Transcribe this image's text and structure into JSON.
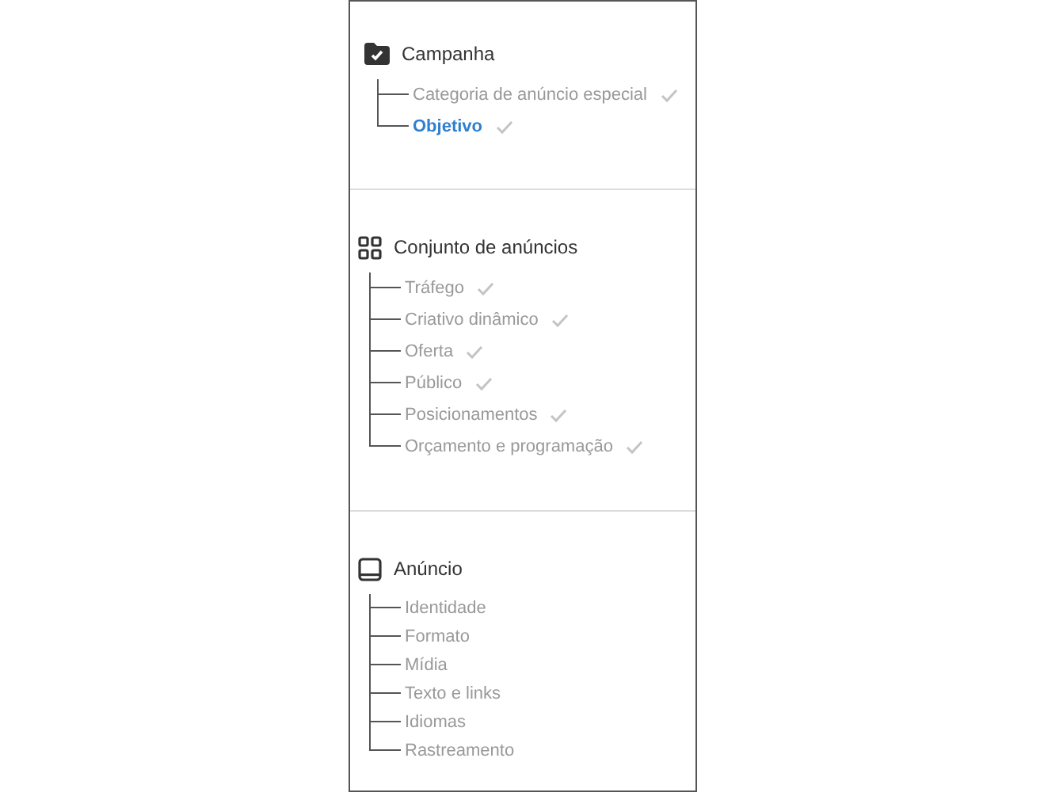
{
  "sections": [
    {
      "kind": "folder-check",
      "title": "Campanha",
      "items": [
        {
          "label": "Categoria de anúncio especial",
          "selected": false,
          "checked": true
        },
        {
          "label": "Objetivo",
          "selected": true,
          "checked": true
        }
      ]
    },
    {
      "kind": "grid",
      "title": "Conjunto de anúncios",
      "items": [
        {
          "label": "Tráfego",
          "selected": false,
          "checked": true
        },
        {
          "label": "Criativo dinâmico",
          "selected": false,
          "checked": true
        },
        {
          "label": "Oferta",
          "selected": false,
          "checked": true
        },
        {
          "label": "Público",
          "selected": false,
          "checked": true
        },
        {
          "label": "Posicionamentos",
          "selected": false,
          "checked": true
        },
        {
          "label": "Orçamento e programação",
          "selected": false,
          "checked": true
        }
      ]
    },
    {
      "kind": "tablet",
      "title": "Anúncio",
      "items": [
        {
          "label": "Identidade",
          "selected": false,
          "checked": false
        },
        {
          "label": "Formato",
          "selected": false,
          "checked": false
        },
        {
          "label": "Mídia",
          "selected": false,
          "checked": false
        },
        {
          "label": "Texto e links",
          "selected": false,
          "checked": false
        },
        {
          "label": "Idiomas",
          "selected": false,
          "checked": false
        },
        {
          "label": "Rastreamento",
          "selected": false,
          "checked": false
        }
      ]
    }
  ]
}
